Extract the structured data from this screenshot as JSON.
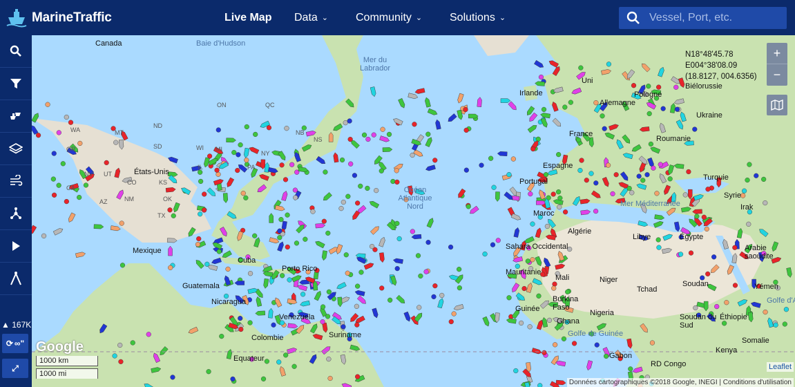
{
  "header": {
    "logo_text": "MarineTraffic",
    "nav": [
      {
        "label": "Live Map",
        "active": true
      },
      {
        "label": "Data",
        "dropdown": true
      },
      {
        "label": "Community",
        "dropdown": true
      },
      {
        "label": "Solutions",
        "dropdown": true
      }
    ],
    "search_placeholder": "Vessel, Port, etc."
  },
  "sidebar": {
    "buttons": [
      "search-icon",
      "filter-icon",
      "fleet-icon",
      "layers-icon",
      "weather-icon",
      "network-icon",
      "play-icon",
      "measure-icon"
    ],
    "vessel_count": "167K",
    "refresh_label": "∞\"",
    "expand_label": "⤢"
  },
  "map": {
    "coordinates": [
      "N18°48'45.78",
      "E004°38'08.09",
      "(18.8127, 004.6356)"
    ],
    "zoom_in": "+",
    "zoom_out": "−",
    "scale_km": "1000 km",
    "scale_mi": "1000 mi",
    "google": "Google",
    "attribution": "Données cartographiques ©2018 Google, INEGI",
    "terms": "Conditions d'utilisation",
    "leaflet": "Leaflet",
    "colors": {
      "land": "#e8e2d6",
      "green_land": "#c5e0a8",
      "sea": "#aadaff",
      "cargo": "#3ec53e",
      "tanker": "#e8242a",
      "passenger": "#2136d4",
      "fishing": "#f2a16b",
      "special": "#21d4e0",
      "unknown": "#b7b7b7",
      "highspeed": "#e040e8"
    },
    "labels": [
      {
        "text": "Canada",
        "type": "country"
      },
      {
        "text": "Baie d'Hudson",
        "type": "sea"
      },
      {
        "text": "Mer du Labrador",
        "type": "sea"
      },
      {
        "text": "États-Unis",
        "type": "country"
      },
      {
        "text": "Mexique",
        "type": "country"
      },
      {
        "text": "Cuba",
        "type": "country"
      },
      {
        "text": "Porto Rico",
        "type": "country"
      },
      {
        "text": "Guatemala",
        "type": "country"
      },
      {
        "text": "Nicaragua",
        "type": "country"
      },
      {
        "text": "Venezuela",
        "type": "country"
      },
      {
        "text": "Colombie",
        "type": "country"
      },
      {
        "text": "Suriname",
        "type": "country"
      },
      {
        "text": "Equateur",
        "type": "country"
      },
      {
        "text": "Océan Atlantique Nord",
        "type": "sea"
      },
      {
        "text": "Irlande",
        "type": "country"
      },
      {
        "text": "Uni",
        "type": "country"
      },
      {
        "text": "Allemagne",
        "type": "country"
      },
      {
        "text": "Pologne",
        "type": "country"
      },
      {
        "text": "Biélorussie",
        "type": "country"
      },
      {
        "text": "Ukraine",
        "type": "country"
      },
      {
        "text": "France",
        "type": "country"
      },
      {
        "text": "Roumanie",
        "type": "country"
      },
      {
        "text": "Espagne",
        "type": "country"
      },
      {
        "text": "Portugal",
        "type": "country"
      },
      {
        "text": "Turquie",
        "type": "country"
      },
      {
        "text": "Syrie",
        "type": "country"
      },
      {
        "text": "Irak",
        "type": "country"
      },
      {
        "text": "Mer Méditerranée",
        "type": "sea"
      },
      {
        "text": "Maroc",
        "type": "country"
      },
      {
        "text": "Algérie",
        "type": "country"
      },
      {
        "text": "Libye",
        "type": "country"
      },
      {
        "text": "Égypte",
        "type": "country"
      },
      {
        "text": "Arabie saoudite",
        "type": "country"
      },
      {
        "text": "Sahara Occidental",
        "type": "country"
      },
      {
        "text": "Mauritanie",
        "type": "country"
      },
      {
        "text": "Mali",
        "type": "country"
      },
      {
        "text": "Niger",
        "type": "country"
      },
      {
        "text": "Tchad",
        "type": "country"
      },
      {
        "text": "Soudan",
        "type": "country"
      },
      {
        "text": "Yémen",
        "type": "country"
      },
      {
        "text": "Guinée",
        "type": "country"
      },
      {
        "text": "Burkina Faso",
        "type": "country"
      },
      {
        "text": "Nigeria",
        "type": "country"
      },
      {
        "text": "Ghana",
        "type": "country"
      },
      {
        "text": "Soudan du Sud",
        "type": "country"
      },
      {
        "text": "Éthiopie",
        "type": "country"
      },
      {
        "text": "Somalie",
        "type": "country"
      },
      {
        "text": "Kenya",
        "type": "country"
      },
      {
        "text": "Gabon",
        "type": "country"
      },
      {
        "text": "RD Congo",
        "type": "country"
      },
      {
        "text": "Golfe d'Aden",
        "type": "sea"
      },
      {
        "text": "Golfe de Guinée",
        "type": "sea"
      }
    ],
    "states": [
      "WA",
      "MT",
      "ND",
      "SD",
      "NV",
      "UT",
      "CO",
      "KS",
      "OK",
      "TX",
      "NM",
      "AZ",
      "CA",
      "OR",
      "WI",
      "MI",
      "IL",
      "PA",
      "NY",
      "NB",
      "QC",
      "ON",
      "NS"
    ]
  }
}
